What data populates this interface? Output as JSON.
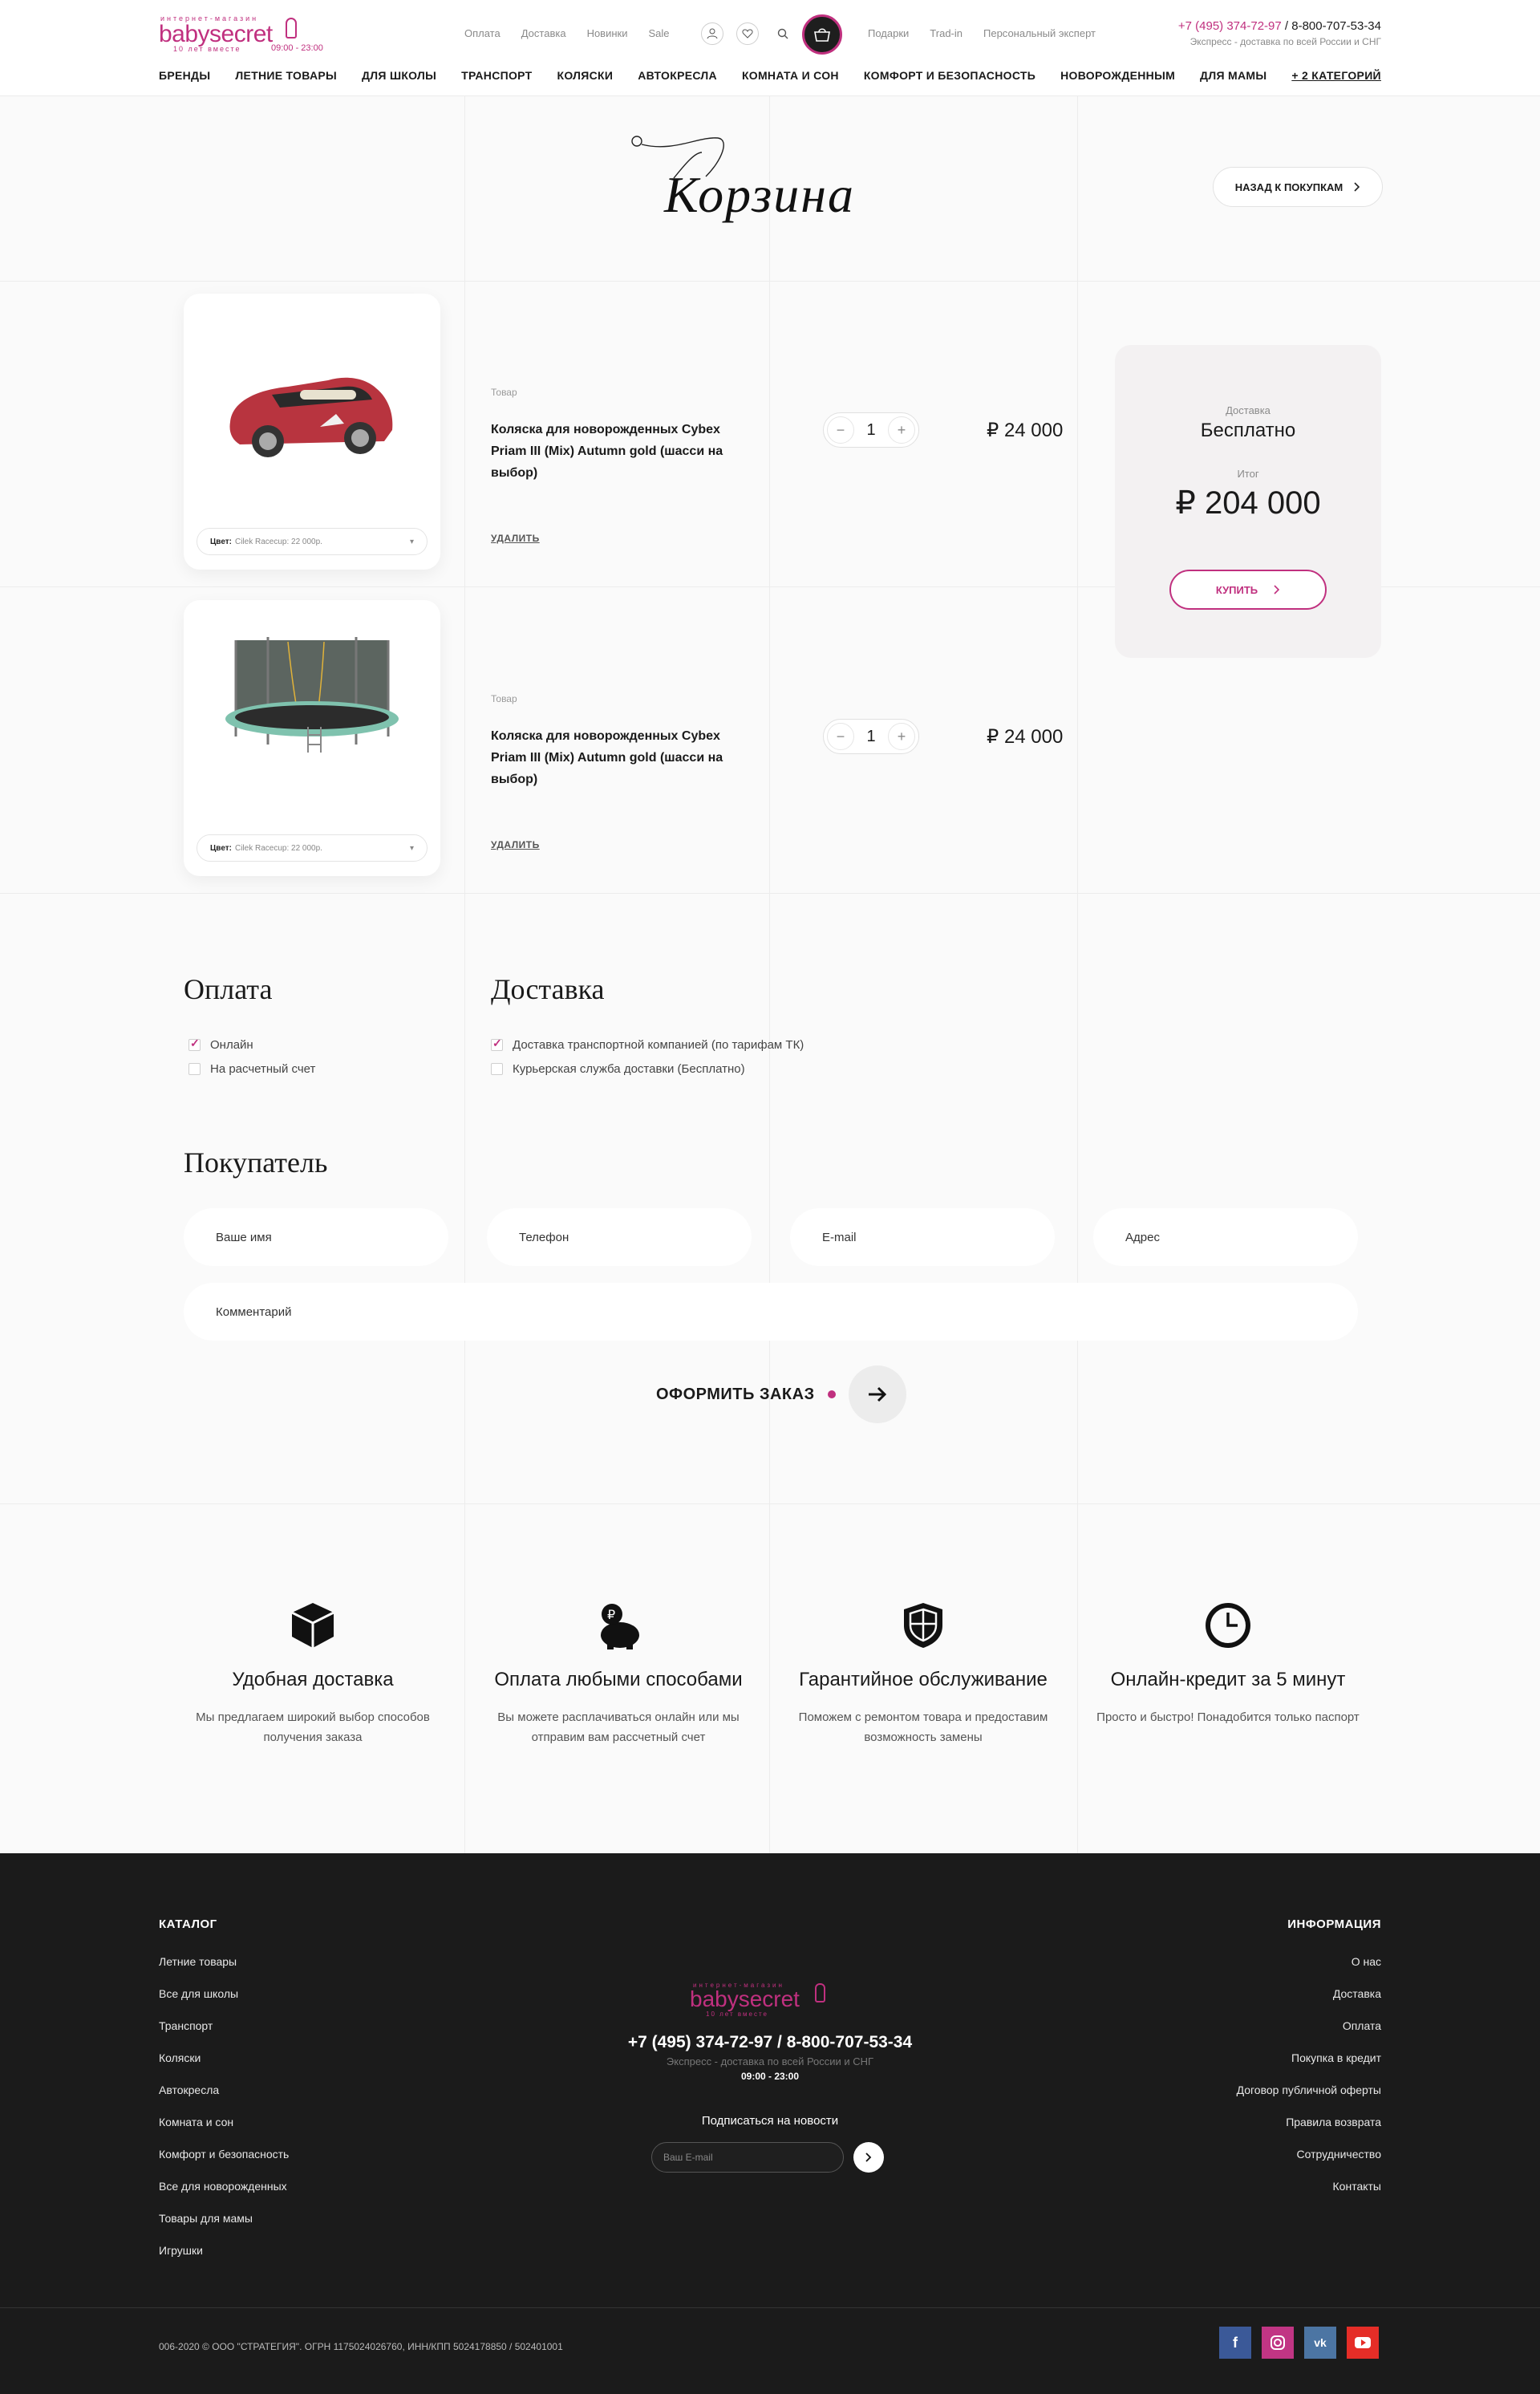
{
  "header": {
    "logo_tagline": "интернет-магазин",
    "logo_word": "babysecret",
    "logo_sub": "10 лет вместе",
    "logo_hours": "09:00 - 23:00",
    "topnav_left": [
      "Оплата",
      "Доставка",
      "Новинки",
      "Sale"
    ],
    "topnav_right": [
      "Подарки",
      "Trad-in",
      "Персональный эксперт"
    ],
    "phone_1": "+7 (495) 374-72-97",
    "phone_sep": " / ",
    "phone_2": "8-800-707-53-34",
    "phone_note": "Экспресс - доставка по всей России и СНГ",
    "categories": [
      "БРЕНДЫ",
      "ЛЕТНИЕ ТОВАРЫ",
      "ДЛЯ ШКОЛЫ",
      "ТРАНСПОРТ",
      "КОЛЯСКИ",
      "АВТОКРЕСЛА",
      "КОМНАТА И СОН",
      "КОМФОРТ И БЕЗОПАСНОСТЬ",
      "НОВОРОЖДЕННЫМ",
      "ДЛЯ МАМЫ",
      "+ 2 КАТЕГОРИЙ"
    ]
  },
  "page": {
    "title": "Корзина",
    "back_label": "НАЗАД К ПОКУПКАМ"
  },
  "cart": {
    "items": [
      {
        "label": "Товар",
        "name": "Коляска для новорожденных Cybex Priam III (Mix) Autumn gold (шасси на выбор)",
        "color_label": "Цвет:",
        "color_value": "Cilek Racecup: 22 000р.",
        "qty": "1",
        "price": "₽ 24 000",
        "remove": "УДАЛИТЬ"
      },
      {
        "label": "Товар",
        "name": "Коляска для новорожденных Cybex Priam III (Mix) Autumn gold (шасси на выбор)",
        "color_label": "Цвет:",
        "color_value": "Cilek Racecup: 22 000р.",
        "qty": "1",
        "price": "₽ 24 000",
        "remove": "УДАЛИТЬ"
      }
    ],
    "summary": {
      "delivery_label": "Доставка",
      "delivery_value": "Бесплатно",
      "total_label": "Итог",
      "total_value": "₽ 204 000",
      "buy_label": "КУПИТЬ"
    }
  },
  "payment": {
    "title": "Оплата",
    "options": [
      {
        "label": "Онлайн",
        "checked": true
      },
      {
        "label": "На расчетный счет",
        "checked": false
      }
    ]
  },
  "delivery": {
    "title": "Доставка",
    "options": [
      {
        "label": "Доставка транспортной компанией (по тарифам ТК)",
        "checked": true
      },
      {
        "label": "Курьерская служба доставки (Бесплатно)",
        "checked": false
      }
    ]
  },
  "buyer": {
    "title": "Покупатель",
    "name_ph": "Ваше имя",
    "phone_ph": "Телефон",
    "email_ph": "E-mail",
    "address_ph": "Адрес",
    "comment_ph": "Комментарий",
    "submit_label": "ОФОРМИТЬ ЗАКАЗ"
  },
  "features": [
    {
      "icon": "box-icon",
      "title": "Удобная доставка",
      "text": "Мы предлагаем широкий выбор способов получения заказа"
    },
    {
      "icon": "piggy-bank-icon",
      "title": "Оплата любыми способами",
      "text": "Вы можете расплачиваться онлайн или мы отправим вам рассчетный счет"
    },
    {
      "icon": "shield-icon",
      "title": "Гарантийное обслуживание",
      "text": "Поможем с ремонтом товара и предоставим возможность замены"
    },
    {
      "icon": "clock-icon",
      "title": "Онлайн-кредит за 5 минут",
      "text": "Просто и быстро! Понадобится только паспорт"
    }
  ],
  "footer": {
    "catalog_title": "КАТАЛОГ",
    "catalog": [
      "Летние товары",
      "Все для школы",
      "Транспорт",
      "Коляски",
      "Автокресла",
      "Комната и сон",
      "Комфорт и безопасность",
      "Все для новорожденных",
      "Товары для мамы",
      "Игрушки"
    ],
    "info_title": "ИНФОРМАЦИЯ",
    "info": [
      "О нас",
      "Доставка",
      "Оплата",
      "Покупка в кредит",
      "Договор публичной оферты",
      "Правила возврата",
      "Сотрудничество",
      "Контакты"
    ],
    "logo_tagline": "интернет-магазин",
    "logo_word": "babysecret",
    "logo_sub": "10 лет вместе",
    "phones": "+7 (495) 374-72-97 / 8-800-707-53-34",
    "phone_note": "Экспресс - доставка по всей России и СНГ",
    "hours": "09:00 - 23:00",
    "subscribe_label": "Подписаться на новости",
    "email_ph": "Ваш E-mail",
    "copyright": "006-2020 © ООО \"СТРАТЕГИЯ\". ОГРН 1175024026760, ИНН/КПП 5024178850 / 502401001",
    "social": [
      "facebook-icon",
      "instagram-icon",
      "vk-icon",
      "youtube-icon"
    ]
  },
  "colors": {
    "accent": "#c0307f",
    "dark": "#1b1b1b",
    "facebook": "#3b5998",
    "instagram": "#c13584",
    "vk": "#4c75a3",
    "youtube": "#e52d27"
  }
}
